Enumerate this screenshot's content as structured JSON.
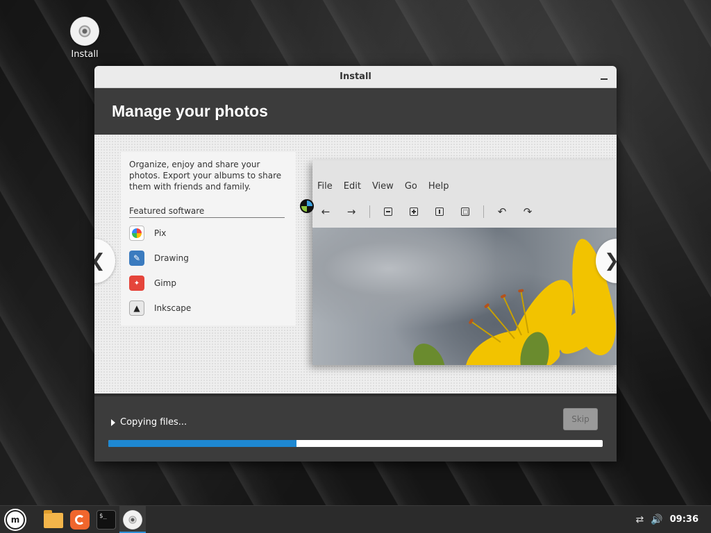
{
  "desktop": {
    "icon_label": "Install"
  },
  "window": {
    "title": "Install",
    "slide_title": "Manage your photos",
    "description": "Organize, enjoy and share your photos. Export your albums to share them with friends and family.",
    "featured_heading": "Featured software",
    "apps": [
      {
        "name": "Pix",
        "icon": "pix-icon"
      },
      {
        "name": "Drawing",
        "icon": "drawing-icon"
      },
      {
        "name": "Gimp",
        "icon": "gimp-icon"
      },
      {
        "name": "Inkscape",
        "icon": "inkscape-icon"
      }
    ],
    "viewer_menus": [
      "File",
      "Edit",
      "View",
      "Go",
      "Help"
    ],
    "nav_prev": "❮",
    "nav_next": "❯"
  },
  "progress": {
    "status": "Copying files...",
    "skip_label": "Skip",
    "fraction": 0.38,
    "fill_color": "#1e88d2"
  },
  "taskbar": {
    "clock": "09:36"
  }
}
